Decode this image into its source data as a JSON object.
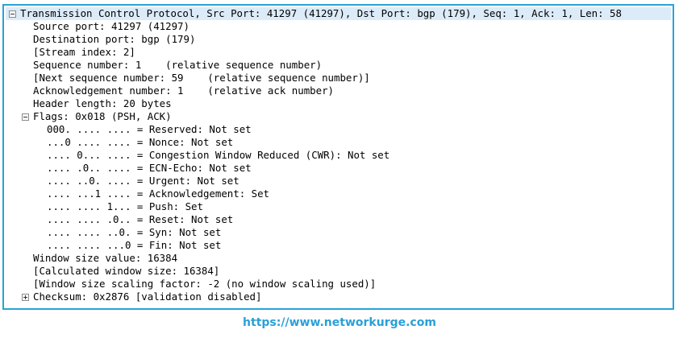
{
  "tree": {
    "header": "Transmission Control Protocol, Src Port: 41297 (41297), Dst Port: bgp (179), Seq: 1, Ack: 1, Len: 58",
    "source_port": "Source port: 41297 (41297)",
    "dest_port": "Destination port: bgp (179)",
    "stream_index": "[Stream index: 2]",
    "seq": "Sequence number: 1    (relative sequence number)",
    "next_seq": "[Next sequence number: 59    (relative sequence number)]",
    "ack": "Acknowledgement number: 1    (relative ack number)",
    "header_length": "Header length: 20 bytes",
    "flags": "Flags: 0x018 (PSH, ACK)",
    "flag_reserved": "000. .... .... = Reserved: Not set",
    "flag_nonce": "...0 .... .... = Nonce: Not set",
    "flag_cwr": ".... 0... .... = Congestion Window Reduced (CWR): Not set",
    "flag_ecn": ".... .0.. .... = ECN-Echo: Not set",
    "flag_urgent": ".... ..0. .... = Urgent: Not set",
    "flag_ack": ".... ...1 .... = Acknowledgement: Set",
    "flag_push": ".... .... 1... = Push: Set",
    "flag_reset": ".... .... .0.. = Reset: Not set",
    "flag_syn": ".... .... ..0. = Syn: Not set",
    "flag_fin": ".... .... ...0 = Fin: Not set",
    "window_size": "Window size value: 16384",
    "calc_window": "[Calculated window size: 16384]",
    "scaling": "[Window size scaling factor: -2 (no window scaling used)]",
    "checksum": "Checksum: 0x2876 [validation disabled]"
  },
  "footer": {
    "url": "https://www.networkurge.com"
  },
  "colors": {
    "frame_border": "#29a3d6",
    "selected_row": "#dcebf8",
    "link": "#2a9fd8"
  },
  "icons": {
    "expanded": "minus-box",
    "collapsed": "plus-box"
  }
}
